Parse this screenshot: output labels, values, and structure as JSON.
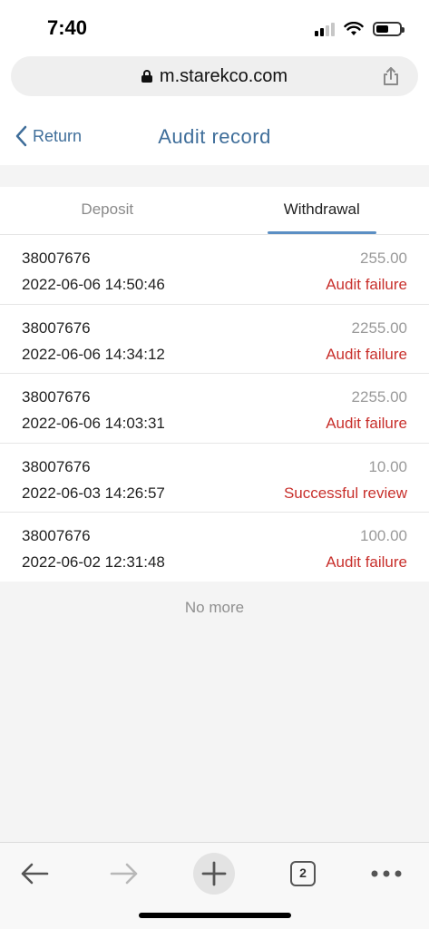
{
  "status_bar": {
    "time": "7:40"
  },
  "browser": {
    "url": "m.starekco.com"
  },
  "header": {
    "back_label": "Return",
    "title": "Audit record"
  },
  "tabs": [
    {
      "label": "Deposit",
      "active": false
    },
    {
      "label": "Withdrawal",
      "active": true
    }
  ],
  "records": [
    {
      "order": "38007676",
      "amount": "255.00",
      "datetime": "2022-06-06 14:50:46",
      "status": "Audit failure"
    },
    {
      "order": "38007676",
      "amount": "2255.00",
      "datetime": "2022-06-06 14:34:12",
      "status": "Audit failure"
    },
    {
      "order": "38007676",
      "amount": "2255.00",
      "datetime": "2022-06-06 14:03:31",
      "status": "Audit failure"
    },
    {
      "order": "38007676",
      "amount": "10.00",
      "datetime": "2022-06-03 14:26:57",
      "status": "Successful review"
    },
    {
      "order": "38007676",
      "amount": "100.00",
      "datetime": "2022-06-02 12:31:48",
      "status": "Audit failure"
    }
  ],
  "list_footer": "No more",
  "toolbar": {
    "tab_count": "2"
  },
  "colors": {
    "accent": "#3f6e9a",
    "tab_indicator": "#5b8fc4",
    "status_text": "#c8302c"
  }
}
